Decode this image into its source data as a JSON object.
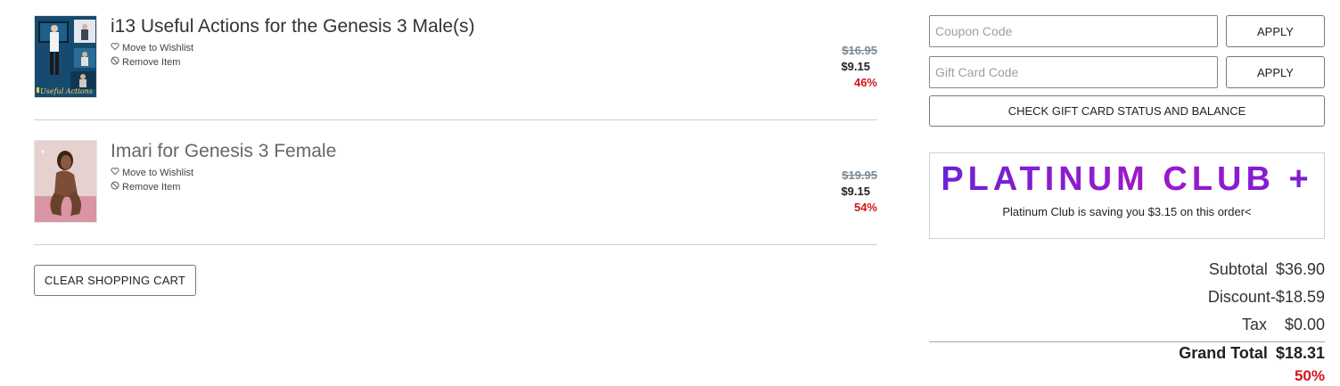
{
  "cart": {
    "items": [
      {
        "title": "i13 Useful Actions for the Genesis 3 Male(s)",
        "wishlist_label": "Move to Wishlist",
        "remove_label": "Remove Item",
        "original_price": "$16.95",
        "price": "$9.15",
        "discount": "46%",
        "thumbnail_caption": "Useful Actions"
      },
      {
        "title": "Imari for Genesis 3 Female",
        "wishlist_label": "Move to Wishlist",
        "remove_label": "Remove Item",
        "original_price": "$19.95",
        "price": "$9.15",
        "discount": "54%"
      }
    ],
    "clear_label": "CLEAR SHOPPING CART"
  },
  "codes": {
    "coupon_placeholder": "Coupon Code",
    "gift_placeholder": "Gift Card Code",
    "apply_label": "APPLY",
    "check_label": "CHECK GIFT CARD STATUS AND BALANCE"
  },
  "platinum": {
    "logo_text": "PLATINUM CLUB +",
    "note": "Platinum Club is saving you $3.15 on this order<"
  },
  "totals": {
    "subtotal_label": "Subtotal",
    "subtotal": "$36.90",
    "discount_label": "Discount",
    "discount": "-$18.59",
    "tax_label": "Tax",
    "tax": "$0.00",
    "grand_label": "Grand Total",
    "grand": "$18.31",
    "savings_pct": "50%"
  },
  "colors": {
    "accent_red": "#d0161b",
    "platinum_purple": "#8b1ec9",
    "border": "#6f7a84"
  },
  "icons": {
    "wishlist": "heart-icon",
    "remove": "prohibited-icon"
  }
}
